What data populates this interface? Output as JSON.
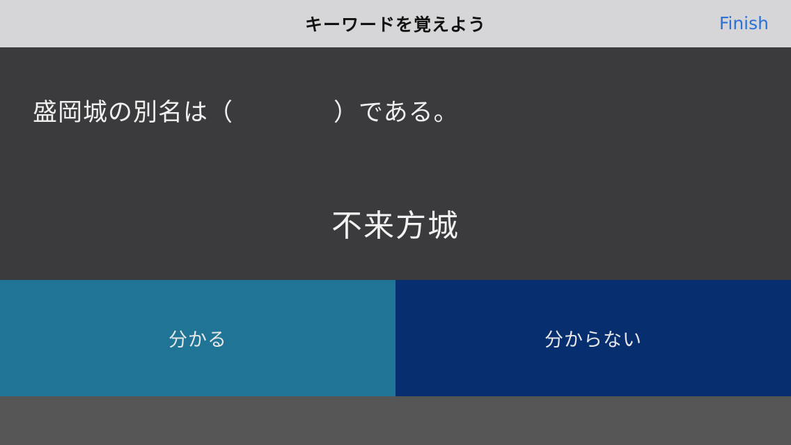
{
  "navbar": {
    "title": "キーワードを覚えよう",
    "finish_label": "Finish"
  },
  "card": {
    "question": "盛岡城の別名は（　　　　）である。",
    "answer": "不来方城"
  },
  "buttons": {
    "know_label": "分かる",
    "dont_know_label": "分からない"
  },
  "colors": {
    "navbar_bg": "#d6d6d8",
    "accent": "#2b71d6",
    "card_bg": "#3b3a3d",
    "know_bg": "#207597",
    "dont_know_bg": "#072f6f"
  }
}
